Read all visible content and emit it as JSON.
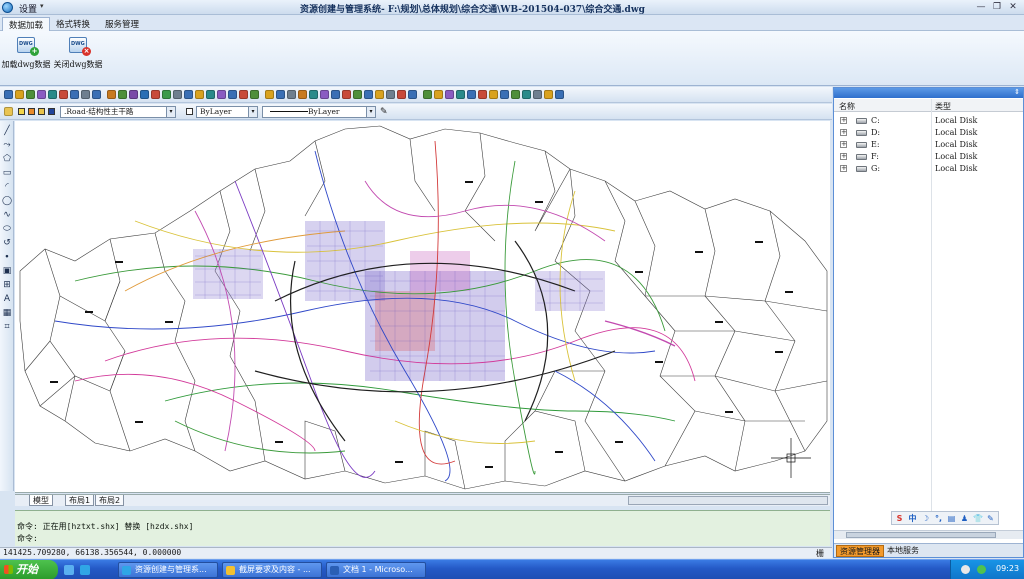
{
  "window": {
    "title": "资源创建与管理系统- F:\\规划\\总体规划\\综合交通\\WB-201504-037\\综合交通.dwg",
    "settings_menu": "设置",
    "settings_arrow": "▾",
    "min": "—",
    "max": "❐",
    "close": "✕"
  },
  "ribbon": {
    "tabs": [
      "数据加载",
      "格式转换",
      "服务管理"
    ],
    "buttons": [
      {
        "label": "加载dwg数据",
        "icon": "dwg-add-icon",
        "badge": "+"
      },
      {
        "label": "关闭dwg数据",
        "icon": "dwg-close-icon",
        "badge": "×"
      }
    ],
    "dwg_icon_text": "DWG"
  },
  "toolbar": {
    "layer_combo": ".Road-结构性主干路",
    "color_combo": "ByLayer",
    "linetype_combo": "ByLayer",
    "dropdown_arrow": "▾",
    "brush": "✎",
    "icon_colors": [
      "#3a6fb5",
      "#d9a21f",
      "#4e8f3a",
      "#8a5cc2",
      "#2a8a8a",
      "#c84a3a",
      "#3a6fb5",
      "#6f7f8f",
      "#3a6fb5",
      "#c87a1f",
      "#4e8f3a",
      "#7a4aa8",
      "#2a6fb5",
      "#c84a3a",
      "#3a9a4a",
      "#6f7f8f",
      "#3a6fb5",
      "#d9a21f",
      "#2a8a8a",
      "#8a5cc2",
      "#3a6fb5",
      "#c84a3a",
      "#4e8f3a",
      "#d9a21f",
      "#3a6fb5",
      "#6f7f8f",
      "#c87a1f",
      "#2a8a8a",
      "#8a5cc2",
      "#3a6fb5",
      "#c84a3a",
      "#4e8f3a",
      "#3a6fb5",
      "#d9a21f",
      "#6f7f8f",
      "#c84a3a",
      "#3a6fb5",
      "#4e8f3a",
      "#d9a21f",
      "#8a5cc2",
      "#2a8a8a",
      "#3a6fb5",
      "#c84a3a",
      "#d9a21f",
      "#3a6fb5",
      "#4e8f3a",
      "#2a8a8a",
      "#6f7f8f",
      "#d9a21f",
      "#3a6fb5"
    ]
  },
  "draw_tools": [
    "╱",
    "⤳",
    "⬠",
    "▭",
    "◜",
    "◯",
    "∿",
    "⬭",
    "↺",
    "∙",
    "▣",
    "⊞",
    "A",
    "▦",
    "⌗"
  ],
  "layout_tabs": [
    "模型",
    "布局1",
    "布局2"
  ],
  "command": {
    "line1": "命令: 正在用[hztxt.shx] 替换 [hzdx.shx]",
    "line2": "命令:"
  },
  "status": {
    "coords": "141425.709280,  66138.356544,  0.000000",
    "tail": "栅"
  },
  "resource_panel": {
    "pin": "⇕",
    "col_name": "名称",
    "col_type": "类型",
    "expander": "+",
    "drives": [
      {
        "name": "C:",
        "type": "Local Disk"
      },
      {
        "name": "D:",
        "type": "Local Disk"
      },
      {
        "name": "E:",
        "type": "Local Disk"
      },
      {
        "name": "F:",
        "type": "Local Disk"
      },
      {
        "name": "G:",
        "type": "Local Disk"
      }
    ],
    "ime": [
      "S",
      "中",
      "☽",
      "°,",
      "▤",
      "♟",
      "👕",
      "✎"
    ],
    "ime_colors": [
      "#d8322a",
      "#1e5fc2",
      "#1e5fc2",
      "#1e5fc2",
      "#1e5fc2",
      "#1e5fc2",
      "#1e5fc2",
      "#1e5fc2"
    ],
    "tabs": [
      "资源管理器",
      "本地服务"
    ]
  },
  "taskbar": {
    "start": "开始",
    "tasks": [
      {
        "label": "资源创建与管理系...",
        "color": "#2fa6e6"
      },
      {
        "label": "截屏要求及内容 - ...",
        "color": "#f2c031"
      },
      {
        "label": "文档 1 - Microso...",
        "color": "#2a5fb5"
      }
    ],
    "clock": "09:23",
    "colors": {
      "quick1": "#5ab0f0",
      "quick2": "#2fa6e6",
      "tray1": "#e8e8e8",
      "tray2": "#4fc24f"
    }
  }
}
